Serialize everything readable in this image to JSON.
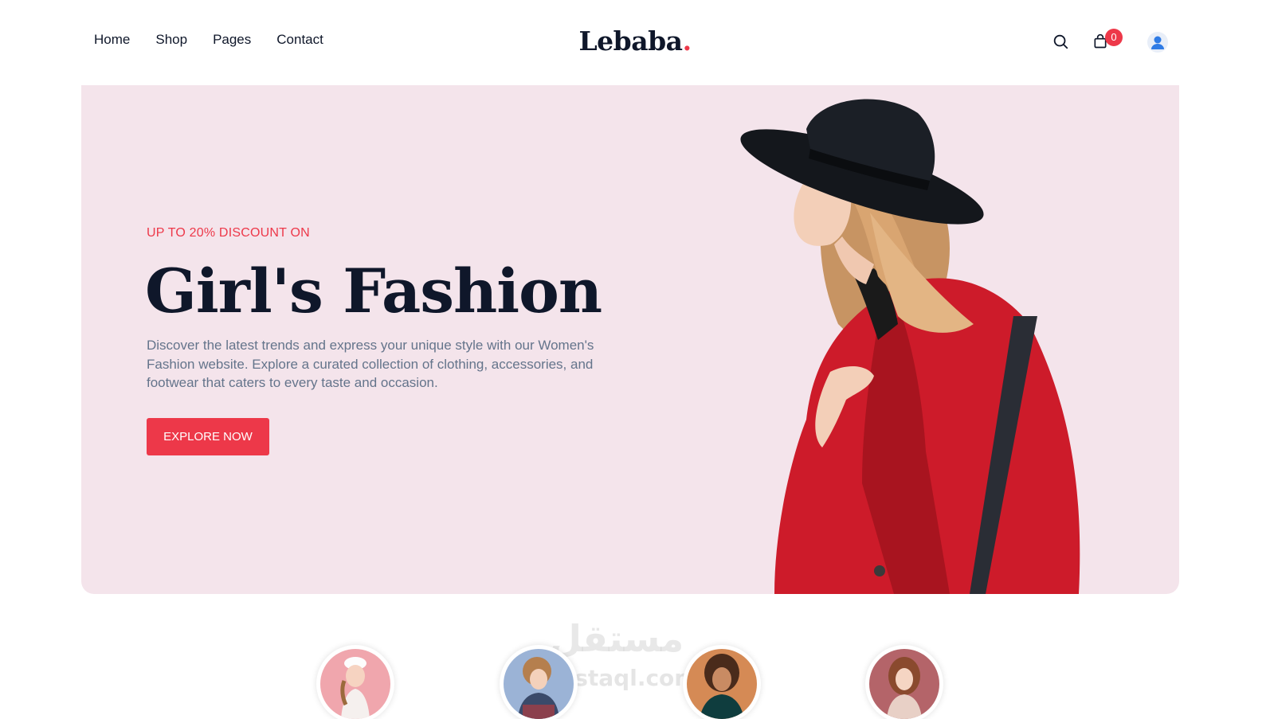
{
  "header": {
    "nav": [
      {
        "label": "Home"
      },
      {
        "label": "Shop"
      },
      {
        "label": "Pages"
      },
      {
        "label": "Contact"
      }
    ],
    "logo": "Lebaba",
    "logo_dot": ".",
    "cart_count": "0",
    "icons": [
      "search-icon",
      "shopping-bag-icon",
      "user-icon"
    ]
  },
  "hero": {
    "subtitle": "UP TO 20% DISCOUNT ON",
    "title": "Girl's Fashion",
    "description": "Discover the latest trends and express your unique style with our Women's Fashion website. Explore a curated collection of clothing, accessories, and footwear that caters to every taste and occasion.",
    "button_label": "EXPLORE NOW"
  },
  "watermark": {
    "text": "مستقل",
    "sub": "ostaql.com"
  },
  "colors": {
    "accent": "#ed3849",
    "hero_bg": "#f4e4eb",
    "text_dark": "#0f172a",
    "text_muted": "#64748b"
  }
}
